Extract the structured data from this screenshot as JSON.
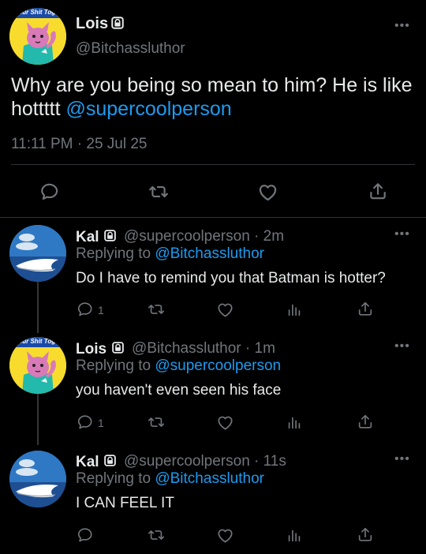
{
  "main_tweet": {
    "display_name": "Lois",
    "handle": "@Bitchassluthor",
    "text_prefix": "Why are you being so mean to him? He is like hottttt ",
    "mention": "@supercoolperson",
    "timestamp": "11:11 PM · 25 Jul 25",
    "avatar_banner": "our Shit Toge"
  },
  "replies": [
    {
      "display_name": "Kal",
      "meta": "@supercoolperson · 2m",
      "replying_label": "Replying to ",
      "replying_handle": "@Bitchassluthor",
      "text": "Do I have to remind you that Batman is hotter?",
      "reply_count": "1",
      "avatar": "shark"
    },
    {
      "display_name": "Lois",
      "meta": "@Bitchassluthor · 1m",
      "replying_label": "Replying to ",
      "replying_handle": "@supercoolperson",
      "text": "you haven't even seen his face",
      "reply_count": "1",
      "avatar_banner": "our Shit Toge",
      "avatar": "cat"
    },
    {
      "display_name": "Kal",
      "meta": "@supercoolperson · 11s",
      "replying_label": "Replying to ",
      "replying_handle": "@Bitchassluthor",
      "text": "I CAN FEEL IT",
      "reply_count": "",
      "avatar": "shark"
    }
  ],
  "colors": {
    "background": "#000000",
    "text": "#e7e9ea",
    "muted": "#71767b",
    "link": "#1d9bf0",
    "divider": "#2f3336"
  },
  "icons": [
    "lock-icon",
    "more-icon",
    "reply-icon",
    "retweet-icon",
    "like-icon",
    "share-icon",
    "views-icon"
  ]
}
